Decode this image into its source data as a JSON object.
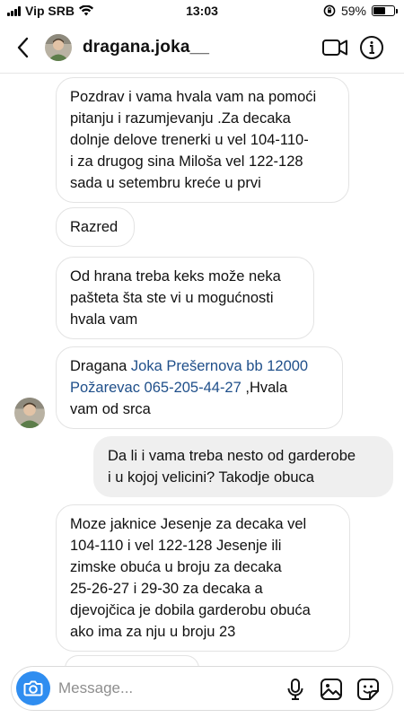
{
  "status_bar": {
    "carrier": "Vip SRB",
    "time": "13:03",
    "battery": "59%",
    "battery_level": 0.59
  },
  "header": {
    "username": "dragana.joka__",
    "icons": [
      "back-icon",
      "video-call-icon",
      "info-icon"
    ]
  },
  "messages": [
    {
      "side": "in",
      "lines": [
        "Pozdrav i vama hvala vam na pomoći",
        "pitanju i razumjevanju .Za decaka",
        "dolnje delove trenerki u vel 104-110-",
        "i za drugog sina Miloša vel 122-128",
        "sada u setembru kreće u prvi"
      ]
    },
    {
      "side": "in",
      "lines": [
        "Razred"
      ]
    },
    {
      "side": "in",
      "lines": [
        "Od hrana treba keks može neka",
        "pašteta  šta ste vi u mogućnosti",
        "hvala vam"
      ]
    },
    {
      "side": "in",
      "intro": "Dragana ",
      "link1": "Joka Prešernova bb 12000",
      "link2": "Požarevac 065-205-44-27",
      "after": " ,Hvala",
      "last": "vam od srca"
    },
    {
      "side": "out",
      "lines": [
        "Da li i vama treba nesto od garderobe",
        "i u kojoj velicini? Takodje obuca"
      ]
    },
    {
      "side": "in",
      "lines": [
        "Moze jaknice Jesenje za decaka vel",
        "104-110 i vel 122-128 Jesenje ili",
        "zimske obuća u broju za decaka",
        "25-26-27 i 29-30 za decaka a",
        "djevojčica je dobila garderobu obuća",
        "ako ima za nju u broju 23"
      ]
    }
  ],
  "composer": {
    "placeholder": "Message...",
    "icons": [
      "camera-icon",
      "microphone-icon",
      "gallery-icon",
      "sticker-icon"
    ]
  },
  "colors": {
    "camera_button": "#2f8df0",
    "link": "#1f4f8a",
    "outgoing_bubble": "#efefef",
    "incoming_border": "#e3e3e3"
  }
}
